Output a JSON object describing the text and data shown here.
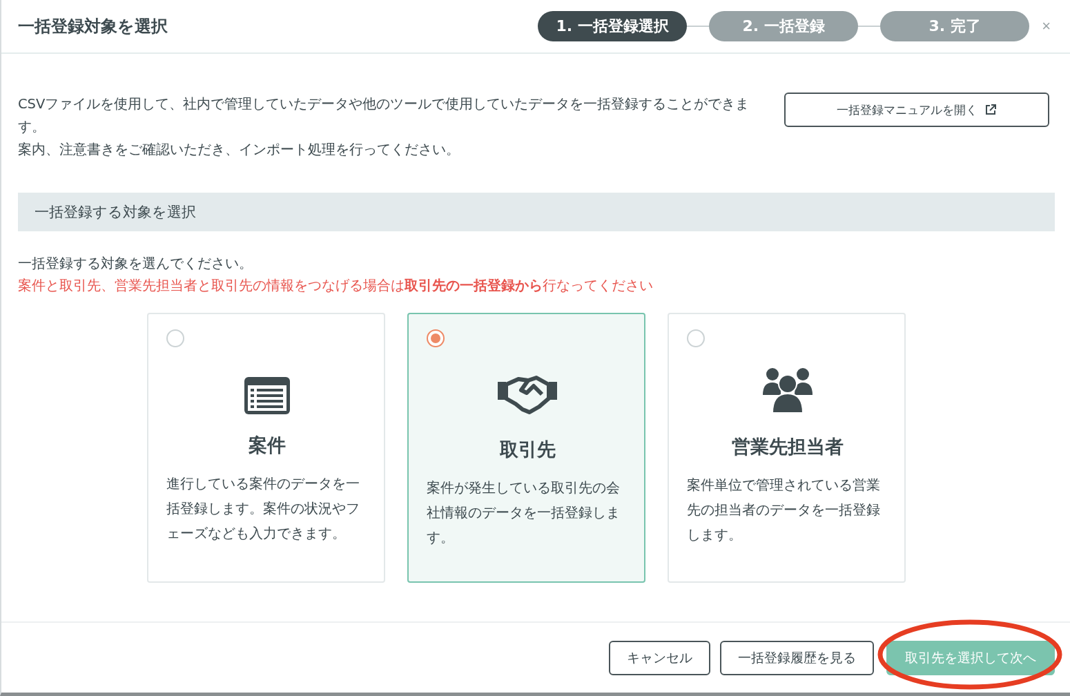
{
  "dialog": {
    "title": "一括登録対象を選択"
  },
  "steps": [
    {
      "label": "1. 一括登録選択",
      "selected": true
    },
    {
      "label": "2. 一括登録",
      "selected": false
    },
    {
      "label": "3. 完了",
      "selected": false
    }
  ],
  "close": "×",
  "intro": {
    "lines": [
      "CSVファイルを使用して、社内で管理していたデータや他のツールで使用していたデータを一括登録することができます。",
      "案内、注意書きをご確認いただき、インポート処理を行ってください。"
    ],
    "manual_button": "一括登録マニュアルを開く"
  },
  "section": {
    "title": "一括登録する対象を選択",
    "prompt": "一括登録する対象を選んでください。",
    "notice": "案件と取引先、営業先担当者と取引先の情報をつなげる場合は**取引先の一括登録から**行なってください"
  },
  "options": [
    {
      "kind": "list",
      "title": "案件",
      "description": "進行している案件のデータを一括登録します。案件の状況やフェーズなども入力できます。",
      "selected": false
    },
    {
      "kind": "handshake",
      "title": "取引先",
      "description": "案件が発生している取引先の会社情報のデータを一括登録します。",
      "selected": true
    },
    {
      "kind": "people",
      "title": "営業先担当者",
      "description": "案件単位で管理されている営業先の担当者のデータを一括登録します。",
      "selected": false
    }
  ],
  "footer": {
    "cancel": "キャンセル",
    "history": "一括登録履歴を見る",
    "next": "取引先を選択して次へ"
  }
}
